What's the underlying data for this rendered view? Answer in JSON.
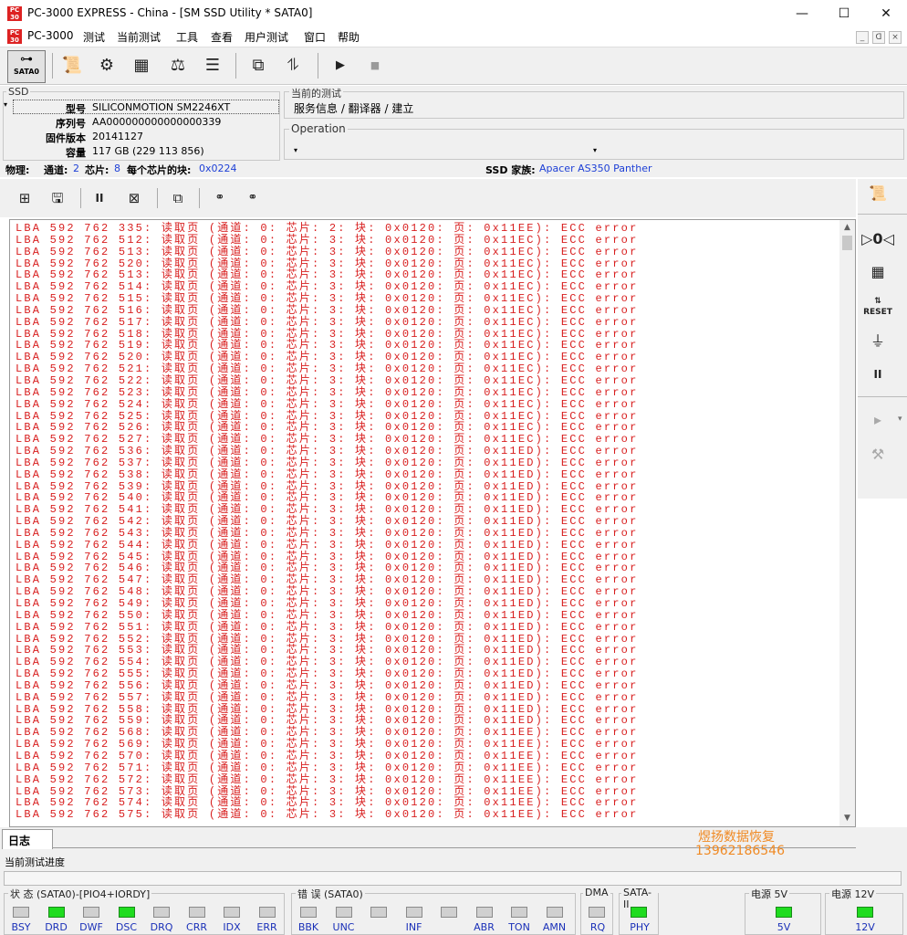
{
  "window": {
    "title": "PC-3000 EXPRESS - China - [SM SSD Utility * SATA0]",
    "app_icon_text": "PC\n3000",
    "minimize": "—",
    "maximize": "☐",
    "close": "✕"
  },
  "menu": {
    "items": [
      "PC-3000",
      "测试",
      "当前测试",
      "工具",
      "查看",
      "用户测试",
      "窗口",
      "帮助"
    ],
    "mdi": [
      "_",
      "ᗡ",
      "×"
    ]
  },
  "toolbar": {
    "sata_label": "SATA0"
  },
  "ssd": {
    "group_title": "SSD",
    "model_label": "型号",
    "model_value": "SILICONMOTION SM2246XT",
    "serial_label": "序列号",
    "serial_value": "AA000000000000000339",
    "firmware_label": "固件版本",
    "firmware_value": "20141127",
    "capacity_label": "容量",
    "capacity_value": "117 GB (229 113 856)"
  },
  "current_test": {
    "group_title": "当前的测试",
    "value": "服务信息 / 翻译器 / 建立",
    "operation_title": "Operation"
  },
  "physical": {
    "label": "物理:",
    "channels_label": "通道:",
    "channels_value": "2",
    "chips_label": "芯片:",
    "chips_value": "8",
    "blocks_label": "每个芯片的块:",
    "blocks_value": "0x0224",
    "family_label": "SSD 家族:",
    "family_value": "Apacer AS350 Panther"
  },
  "log": {
    "lines": [
      "LBA 592 762 335: 读取页 (通道: 0: 芯片: 2: 块: 0x0120: 页: 0x11EE): ECC error",
      "LBA 592 762 512: 读取页 (通道: 0: 芯片: 3: 块: 0x0120: 页: 0x11EC): ECC error",
      "LBA 592 762 513: 读取页 (通道: 0: 芯片: 3: 块: 0x0120: 页: 0x11EC): ECC error",
      "LBA 592 762 520: 读取页 (通道: 0: 芯片: 3: 块: 0x0120: 页: 0x11EC): ECC error",
      "LBA 592 762 513: 读取页 (通道: 0: 芯片: 3: 块: 0x0120: 页: 0x11EC): ECC error",
      "LBA 592 762 514: 读取页 (通道: 0: 芯片: 3: 块: 0x0120: 页: 0x11EC): ECC error",
      "LBA 592 762 515: 读取页 (通道: 0: 芯片: 3: 块: 0x0120: 页: 0x11EC): ECC error",
      "LBA 592 762 516: 读取页 (通道: 0: 芯片: 3: 块: 0x0120: 页: 0x11EC): ECC error",
      "LBA 592 762 517: 读取页 (通道: 0: 芯片: 3: 块: 0x0120: 页: 0x11EC): ECC error",
      "LBA 592 762 518: 读取页 (通道: 0: 芯片: 3: 块: 0x0120: 页: 0x11EC): ECC error",
      "LBA 592 762 519: 读取页 (通道: 0: 芯片: 3: 块: 0x0120: 页: 0x11EC): ECC error",
      "LBA 592 762 520: 读取页 (通道: 0: 芯片: 3: 块: 0x0120: 页: 0x11EC): ECC error",
      "LBA 592 762 521: 读取页 (通道: 0: 芯片: 3: 块: 0x0120: 页: 0x11EC): ECC error",
      "LBA 592 762 522: 读取页 (通道: 0: 芯片: 3: 块: 0x0120: 页: 0x11EC): ECC error",
      "LBA 592 762 523: 读取页 (通道: 0: 芯片: 3: 块: 0x0120: 页: 0x11EC): ECC error",
      "LBA 592 762 524: 读取页 (通道: 0: 芯片: 3: 块: 0x0120: 页: 0x11EC): ECC error",
      "LBA 592 762 525: 读取页 (通道: 0: 芯片: 3: 块: 0x0120: 页: 0x11EC): ECC error",
      "LBA 592 762 526: 读取页 (通道: 0: 芯片: 3: 块: 0x0120: 页: 0x11EC): ECC error",
      "LBA 592 762 527: 读取页 (通道: 0: 芯片: 3: 块: 0x0120: 页: 0x11EC): ECC error",
      "LBA 592 762 536: 读取页 (通道: 0: 芯片: 3: 块: 0x0120: 页: 0x11ED): ECC error",
      "LBA 592 762 537: 读取页 (通道: 0: 芯片: 3: 块: 0x0120: 页: 0x11ED): ECC error",
      "LBA 592 762 538: 读取页 (通道: 0: 芯片: 3: 块: 0x0120: 页: 0x11ED): ECC error",
      "LBA 592 762 539: 读取页 (通道: 0: 芯片: 3: 块: 0x0120: 页: 0x11ED): ECC error",
      "LBA 592 762 540: 读取页 (通道: 0: 芯片: 3: 块: 0x0120: 页: 0x11ED): ECC error",
      "LBA 592 762 541: 读取页 (通道: 0: 芯片: 3: 块: 0x0120: 页: 0x11ED): ECC error",
      "LBA 592 762 542: 读取页 (通道: 0: 芯片: 3: 块: 0x0120: 页: 0x11ED): ECC error",
      "LBA 592 762 543: 读取页 (通道: 0: 芯片: 3: 块: 0x0120: 页: 0x11ED): ECC error",
      "LBA 592 762 544: 读取页 (通道: 0: 芯片: 3: 块: 0x0120: 页: 0x11ED): ECC error",
      "LBA 592 762 545: 读取页 (通道: 0: 芯片: 3: 块: 0x0120: 页: 0x11ED): ECC error",
      "LBA 592 762 546: 读取页 (通道: 0: 芯片: 3: 块: 0x0120: 页: 0x11ED): ECC error",
      "LBA 592 762 547: 读取页 (通道: 0: 芯片: 3: 块: 0x0120: 页: 0x11ED): ECC error",
      "LBA 592 762 548: 读取页 (通道: 0: 芯片: 3: 块: 0x0120: 页: 0x11ED): ECC error",
      "LBA 592 762 549: 读取页 (通道: 0: 芯片: 3: 块: 0x0120: 页: 0x11ED): ECC error",
      "LBA 592 762 550: 读取页 (通道: 0: 芯片: 3: 块: 0x0120: 页: 0x11ED): ECC error",
      "LBA 592 762 551: 读取页 (通道: 0: 芯片: 3: 块: 0x0120: 页: 0x11ED): ECC error",
      "LBA 592 762 552: 读取页 (通道: 0: 芯片: 3: 块: 0x0120: 页: 0x11ED): ECC error",
      "LBA 592 762 553: 读取页 (通道: 0: 芯片: 3: 块: 0x0120: 页: 0x11ED): ECC error",
      "LBA 592 762 554: 读取页 (通道: 0: 芯片: 3: 块: 0x0120: 页: 0x11ED): ECC error",
      "LBA 592 762 555: 读取页 (通道: 0: 芯片: 3: 块: 0x0120: 页: 0x11ED): ECC error",
      "LBA 592 762 556: 读取页 (通道: 0: 芯片: 3: 块: 0x0120: 页: 0x11ED): ECC error",
      "LBA 592 762 557: 读取页 (通道: 0: 芯片: 3: 块: 0x0120: 页: 0x11ED): ECC error",
      "LBA 592 762 558: 读取页 (通道: 0: 芯片: 3: 块: 0x0120: 页: 0x11ED): ECC error",
      "LBA 592 762 559: 读取页 (通道: 0: 芯片: 3: 块: 0x0120: 页: 0x11ED): ECC error",
      "LBA 592 762 568: 读取页 (通道: 0: 芯片: 3: 块: 0x0120: 页: 0x11EE): ECC error",
      "LBA 592 762 569: 读取页 (通道: 0: 芯片: 3: 块: 0x0120: 页: 0x11EE): ECC error",
      "LBA 592 762 570: 读取页 (通道: 0: 芯片: 3: 块: 0x0120: 页: 0x11EE): ECC error",
      "LBA 592 762 571: 读取页 (通道: 0: 芯片: 3: 块: 0x0120: 页: 0x11EE): ECC error",
      "LBA 592 762 572: 读取页 (通道: 0: 芯片: 3: 块: 0x0120: 页: 0x11EE): ECC error",
      "LBA 592 762 573: 读取页 (通道: 0: 芯片: 3: 块: 0x0120: 页: 0x11EE): ECC error",
      "LBA 592 762 574: 读取页 (通道: 0: 芯片: 3: 块: 0x0120: 页: 0x11EE): ECC error",
      "LBA 592 762 575: 读取页 (通道: 0: 芯片: 3: 块: 0x0120: 页: 0x11EE): ECC error"
    ],
    "text_color": "#d81e1e"
  },
  "bottom": {
    "tab_label": "日志",
    "watermark_line1": "煜扬数据恢复",
    "watermark_line2": "13962186546",
    "progress_label": "当前测试进度"
  },
  "status": {
    "state_title": "状 态 (SATA0)-[PIO4+IORDY]",
    "state_leds": [
      {
        "label": "BSY",
        "on": false
      },
      {
        "label": "DRD",
        "on": true
      },
      {
        "label": "DWF",
        "on": false
      },
      {
        "label": "DSC",
        "on": true
      },
      {
        "label": "DRQ",
        "on": false
      },
      {
        "label": "CRR",
        "on": false
      },
      {
        "label": "IDX",
        "on": false
      },
      {
        "label": "ERR",
        "on": false
      }
    ],
    "error_title": "错 误 (SATA0)",
    "error_leds": [
      {
        "label": "BBK",
        "on": false
      },
      {
        "label": "UNC",
        "on": false
      },
      {
        "label": "",
        "on": false
      },
      {
        "label": "INF",
        "on": false
      },
      {
        "label": "",
        "on": false
      },
      {
        "label": "ABR",
        "on": false
      },
      {
        "label": "TON",
        "on": false
      },
      {
        "label": "AMN",
        "on": false
      }
    ],
    "dma_title": "DMA",
    "dma_led": {
      "label": "RQ",
      "on": false
    },
    "sata_title": "SATA-II",
    "sata_led": {
      "label": "PHY",
      "on": true
    },
    "power5_title": "电源 5V",
    "power5_led": {
      "label": "5V",
      "on": true
    },
    "power12_title": "电源 12V",
    "power12_led": {
      "label": "12V",
      "on": true
    }
  },
  "colors": {
    "led_on": "#1fdc1f",
    "led_off": "#d0d0d0",
    "accent_blue": "#1d3fd6",
    "watermark": "#f08a24"
  }
}
